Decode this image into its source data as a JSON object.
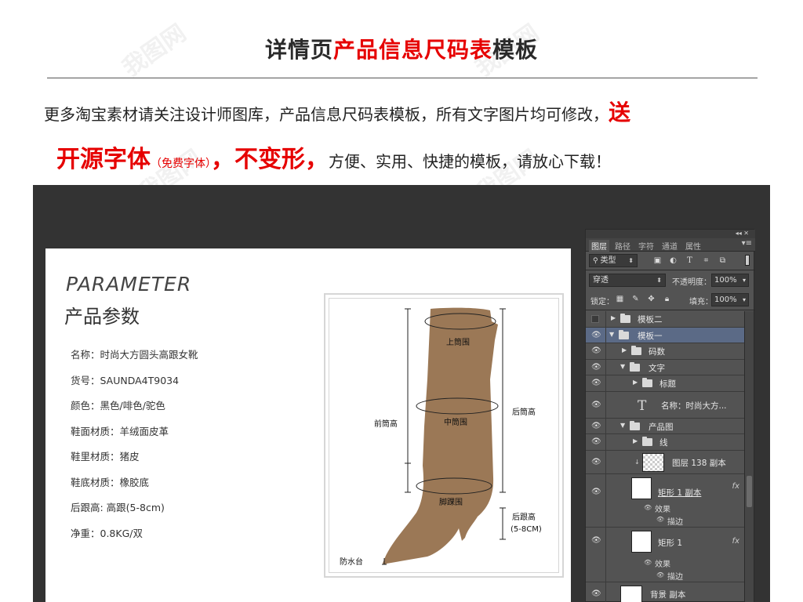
{
  "header": {
    "title_prefix": "详情页",
    "title_highlight": "产品信息尺码表",
    "title_suffix": "模板"
  },
  "intro": {
    "line1_text": "更多淘宝素材请关注设计师图库，产品信息尺码表模板，所有文字图片均可修改，",
    "line1_red": "送",
    "line2_red1": "开源字体",
    "line2_small": "（免费字体）",
    "line2_red2": "，不变形，",
    "line2_text": "方便、实用、快捷的模板，请放心下载！"
  },
  "watermark": "我图网",
  "card": {
    "param_en": "PARAMETER",
    "param_cn": "产品参数",
    "specs": [
      "名称：时尚大方圆头高跟女靴",
      "货号：SAUNDA4T9034",
      "颜色：黑色/啡色/驼色",
      "鞋面材质：羊绒面皮革",
      "鞋里材质：猪皮",
      "鞋底材质：橡胶底",
      "后跟高: 高跟(5-8cm)",
      "净重：0.8KG/双"
    ]
  },
  "diagram": {
    "upper_circ": "上筒围",
    "mid_circ": "中筒围",
    "ankle_circ": "脚踝围",
    "front_height": "前筒高",
    "back_height": "后筒高",
    "heel_height": "后跟高",
    "heel_range": "(5-8CM)",
    "platform": "防水台",
    "boot_color": "#9b7856"
  },
  "ps": {
    "window_controls": "◂◂  ✕",
    "tabs": [
      "图层",
      "路径",
      "字符",
      "通道",
      "属性"
    ],
    "menu": "▾≡",
    "filter_kind": "类型",
    "blend_mode": "穿透",
    "opacity_label": "不透明度：",
    "opacity_value": "100%",
    "lock_label": "锁定：",
    "fill_label": "填充：",
    "fill_value": "100%",
    "layers": {
      "template2": "模板二",
      "template1": "模板一",
      "sizes": "码数",
      "text": "文字",
      "title": "标题",
      "name_text": "名称：时尚大方...",
      "product_img": "产品图",
      "lines": "线",
      "layer138": "图层 138 副本",
      "rect1_copy": "矩形 1 副本",
      "effects": "效果",
      "stroke": "描边",
      "rect1": "矩形 1",
      "effects2": "效果",
      "stroke2": "描边",
      "bg_copy": "背景 副本"
    },
    "fx": "fx"
  }
}
